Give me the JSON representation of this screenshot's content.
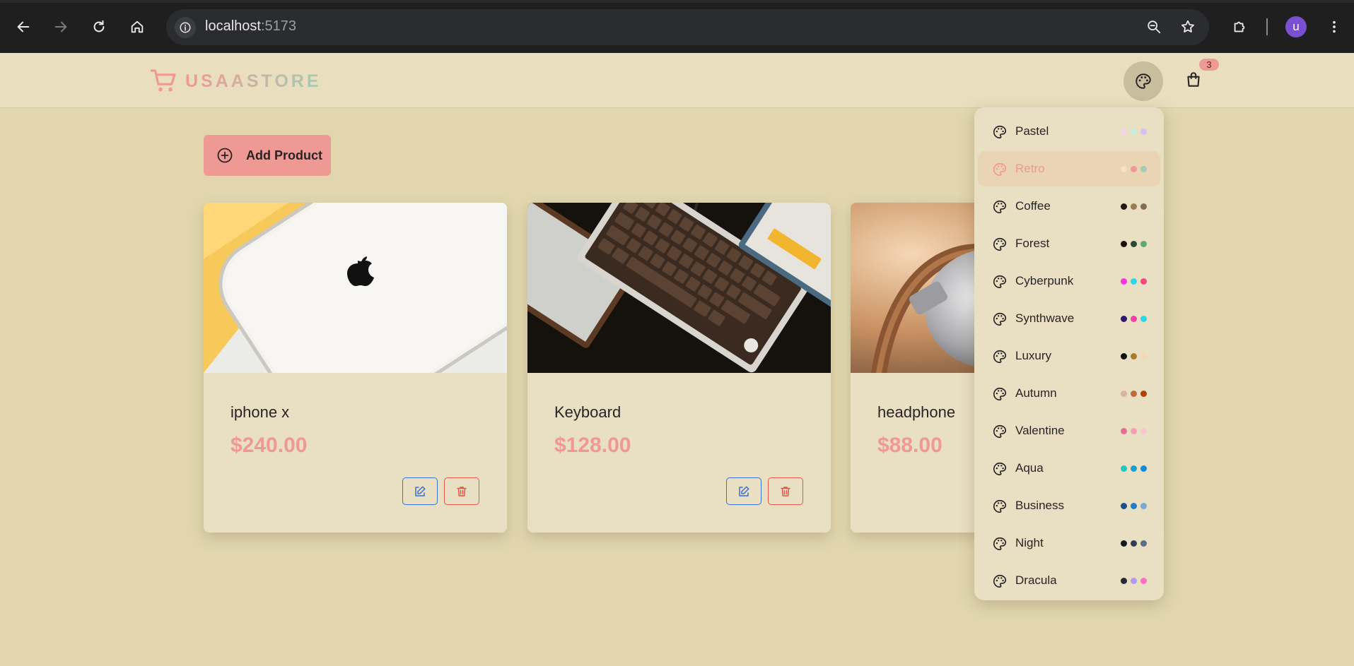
{
  "browser": {
    "url_host": "localhost",
    "url_port": ":5173",
    "profile_initial": "u"
  },
  "navbar": {
    "logo_text": "USAASTORE",
    "cart_count": "3"
  },
  "main": {
    "add_button_label": "Add Product",
    "products": [
      {
        "name": "iphone x",
        "price": "$240.00",
        "image": "white-phone-on-yellow"
      },
      {
        "name": "Keyboard",
        "price": "$128.00",
        "image": "mechanical-keyboards-dark"
      },
      {
        "name": "headphone",
        "price": "$88.00",
        "image": "silver-headphone-brown-band"
      }
    ]
  },
  "theme_menu": {
    "active": "Retro",
    "themes": [
      {
        "name": "Pastel",
        "colors": [
          "#f6d5e6",
          "#c5efd8",
          "#d6bff7"
        ]
      },
      {
        "name": "Retro",
        "colors": [
          "#efe5c6",
          "#ef9995",
          "#a4cbb4"
        ]
      },
      {
        "name": "Coffee",
        "colors": [
          "#1f1a17",
          "#9c7a54",
          "#806e5a"
        ]
      },
      {
        "name": "Forest",
        "colors": [
          "#171212",
          "#2a4a37",
          "#5fa873"
        ]
      },
      {
        "name": "Cyberpunk",
        "colors": [
          "#ff2fe5",
          "#2cd7e8",
          "#f7477e"
        ]
      },
      {
        "name": "Synthwave",
        "colors": [
          "#2b1a6e",
          "#f03fa9",
          "#2cd7e8"
        ]
      },
      {
        "name": "Luxury",
        "colors": [
          "#111111",
          "#a97e2b",
          "#f0d9b3"
        ]
      },
      {
        "name": "Autumn",
        "colors": [
          "#d8b4a6",
          "#c06a3b",
          "#b33f0b"
        ]
      },
      {
        "name": "Valentine",
        "colors": [
          "#e96d93",
          "#f3a0b6",
          "#f8c5d7"
        ]
      },
      {
        "name": "Aqua",
        "colors": [
          "#1dc7c4",
          "#1a9ed6",
          "#108be3"
        ]
      },
      {
        "name": "Business",
        "colors": [
          "#1c4f8c",
          "#257bd0",
          "#79a7d6"
        ]
      },
      {
        "name": "Night",
        "colors": [
          "#0f1729",
          "#323c52",
          "#5c6e87"
        ]
      },
      {
        "name": "Dracula",
        "colors": [
          "#272935",
          "#b798f0",
          "#ff6ec7"
        ]
      }
    ]
  }
}
